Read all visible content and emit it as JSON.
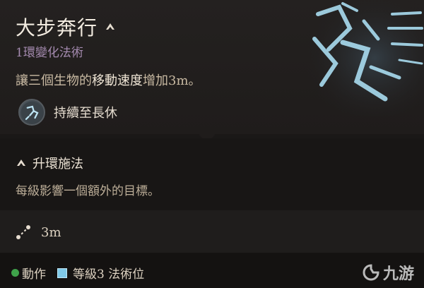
{
  "spell": {
    "name": "大步奔行",
    "subtitle": "1環變化法術",
    "description_prefix": "讓三個生物的",
    "description_highlight": "移動速度",
    "description_suffix": "增加3m。",
    "duration": "持續至長休"
  },
  "upcast": {
    "title": "升環施法",
    "description": "每級影響一個額外的目標。"
  },
  "range": {
    "value": "3m"
  },
  "footer": {
    "action": "動作",
    "slot": "等級3 法術位"
  },
  "watermark": {
    "text": "九游"
  },
  "icons": {
    "title": "upcast-chevron-icon",
    "duration": "longstrider-icon",
    "upcast": "upcast-chevron-icon",
    "range": "range-icon",
    "action": "action-dot-icon",
    "slot": "spell-slot-icon"
  },
  "colors": {
    "subtitle": "#a58bb0",
    "action_dot": "#3fa24a",
    "spell_slot": "#7fc9e8",
    "art_glow": "#a9dcf0"
  }
}
